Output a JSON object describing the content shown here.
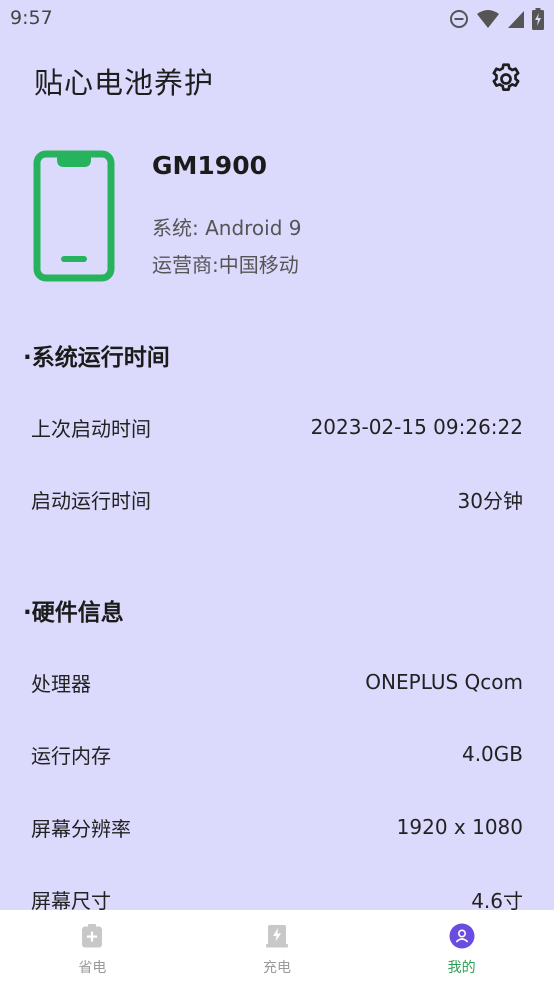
{
  "status_bar": {
    "time": "9:57",
    "icons": [
      "dnd-icon",
      "wifi-icon",
      "signal-icon",
      "battery-charging-icon"
    ]
  },
  "header": {
    "title": "贴心电池养护",
    "settings_icon": "gear-icon"
  },
  "device": {
    "model": "GM1900",
    "system": "系统: Android 9",
    "carrier": "运营商:中国移动",
    "icon": "phone-icon",
    "icon_color": "#27b35d"
  },
  "sections": {
    "runtime": {
      "title": "·系统运行时间",
      "rows": [
        {
          "label": "上次启动时间",
          "value": "2023-02-15 09:26:22"
        },
        {
          "label": "启动运行时间",
          "value": "30分钟"
        }
      ]
    },
    "hardware": {
      "title": "·硬件信息",
      "rows": [
        {
          "label": "处理器",
          "value": "ONEPLUS Qcom"
        },
        {
          "label": "运行内存",
          "value": "4.0GB"
        },
        {
          "label": "屏幕分辨率",
          "value": "1920 x 1080"
        },
        {
          "label": "屏幕尺寸",
          "value": "4.6寸"
        }
      ]
    }
  },
  "bottom_nav": {
    "items": [
      {
        "label": "省电",
        "icon": "battery-saver-icon"
      },
      {
        "label": "充电",
        "icon": "charge-icon"
      },
      {
        "label": "我的",
        "icon": "profile-icon",
        "active": true
      }
    ],
    "active_color": "#2f9e56",
    "profile_icon_color": "#6a4ce0"
  }
}
